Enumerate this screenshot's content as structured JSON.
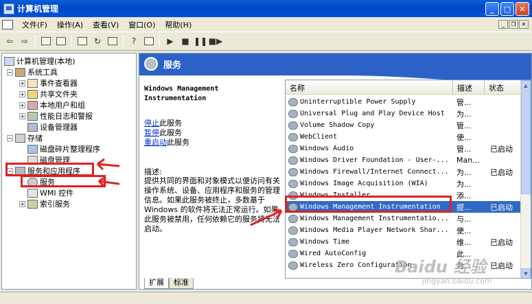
{
  "window": {
    "title": "计算机管理"
  },
  "menu": [
    "文件(F)",
    "操作(A)",
    "查看(V)",
    "窗口(O)",
    "帮助(H)"
  ],
  "toolbar": [
    "back-icon",
    "forward-icon",
    "up-folder-icon",
    "show-hide-tree-icon",
    "properties-icon",
    "refresh-icon",
    "export-list-icon",
    "help-icon",
    "console-icon",
    "start-icon",
    "stop-icon",
    "pause-icon",
    "restart-icon"
  ],
  "tree": {
    "root": "计算机管理(本地)",
    "system_tools": "系统工具",
    "event_viewer": "事件查看器",
    "shared_folders": "共享文件夹",
    "local_users": "本地用户和组",
    "perf_logs": "性能日志和警报",
    "device_manager": "设备管理器",
    "storage": "存储",
    "defrag": "磁盘碎片整理程序",
    "disk_mgmt": "磁盘管理",
    "services_apps": "服务和应用程序",
    "services": "服务",
    "wmi": "WMI 控件",
    "indexing": "索引服务"
  },
  "banner": {
    "title": "服务"
  },
  "details": {
    "service_title": "Windows Management Instrumentation",
    "stop_link": "停止",
    "stop_suffix": "此服务",
    "pause_link": "暂停",
    "pause_suffix": "此服务",
    "restart_link": "重启动",
    "restart_suffix": "此服务",
    "desc_label": "描述:",
    "desc_text": "提供共同的界面和对象模式以便访问有关操作系统、设备、应用程序和服务的管理信息。如果此服务被终止，多数基于 Windows 的软件将无法正常运行。如果此服务被禁用，任何依赖它的服务将无法启动。"
  },
  "list": {
    "headers": {
      "name": "名称",
      "desc": "描述",
      "status": "状态"
    },
    "rows": [
      {
        "name": "Uninterruptible Power Supply",
        "desc": "管...",
        "status": ""
      },
      {
        "name": "Universal Plug and Play Device Host",
        "desc": "为...",
        "status": ""
      },
      {
        "name": "Volume Shadow Copy",
        "desc": "管...",
        "status": ""
      },
      {
        "name": "WebClient",
        "desc": "使...",
        "status": ""
      },
      {
        "name": "Windows Audio",
        "desc": "管...",
        "status": "已启动"
      },
      {
        "name": "Windows Driver Foundation - User-...",
        "desc": "Man...",
        "status": ""
      },
      {
        "name": "Windows Firewall/Internet Connect...",
        "desc": "为...",
        "status": "已启动"
      },
      {
        "name": "Windows Image Acquisition (WIA)",
        "desc": "为...",
        "status": ""
      },
      {
        "name": "Windows Installer",
        "desc": "添...",
        "status": ""
      },
      {
        "name": "Windows Management Instrumentation",
        "desc": "提...",
        "status": "已启动"
      },
      {
        "name": "Windows Management Instrumentatio...",
        "desc": "与...",
        "status": ""
      },
      {
        "name": "Windows Media Player Network Shar...",
        "desc": "使...",
        "status": ""
      },
      {
        "name": "Windows Time",
        "desc": "维...",
        "status": "已启动"
      },
      {
        "name": "Wired AutoConfig",
        "desc": "此...",
        "status": ""
      },
      {
        "name": "Wireless Zero Configuration",
        "desc": "为...",
        "status": "已启动"
      }
    ]
  },
  "tabs": {
    "extended": "扩展",
    "standard": "标准"
  },
  "colors": {
    "selection": "#316AC5",
    "annotation_red": "#E02020",
    "banner": "#2C62C8"
  },
  "watermark": {
    "logo": "Baidu 经验",
    "url": "jingyan.baidu.com"
  }
}
